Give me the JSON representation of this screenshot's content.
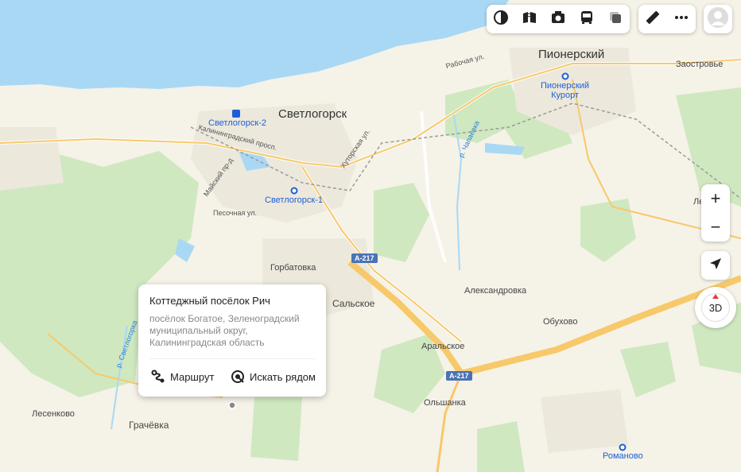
{
  "map_labels": {
    "pionersky": "Пионерский",
    "zaostrovye": "Заостровье",
    "pionersky_kurort": "Пионерский\nКурорт",
    "svetlogorsk": "Светлогорск",
    "svetlogorsk2": "Светлогорск-2",
    "svetlogorsk1": "Светлогорск-1",
    "kaliningradsky": "Калининградский просп.",
    "maysky": "Майский пр-д",
    "pesochnaya": "Песочная ул.",
    "khutorskaya": "Хуторская ул.",
    "rabochaya": "Рабочая ул.",
    "chapayevka": "р. Чапаевка",
    "svetlogorka": "р. Светлогорка",
    "gorbatovka": "Горбатовка",
    "salskoe": "Сальское",
    "aleksandrovka": "Александровка",
    "obukhovo": "Обухово",
    "aralskoe": "Аральское",
    "olshanka": "Ольшанка",
    "lesenkovo": "Лесенково",
    "grachevka": "Грачёвка",
    "romanovo": "Романово",
    "le": "Ле",
    "road_a217_1": "A-217",
    "road_a217_2": "A-217"
  },
  "popup": {
    "title": "Коттеджный посёлок Рич",
    "address": "посёлок Богатое, Зеленоградский муниципальный округ, Калининградская область",
    "route_label": "Маршрут",
    "nearby_label": "Искать рядом"
  },
  "controls": {
    "zoom_in": "+",
    "zoom_out": "−",
    "mode_3d": "3D"
  },
  "colors": {
    "sea": "#a9d8f5",
    "land": "#f5f2e8",
    "forest": "#cfe8c0",
    "road_major": "#f7c96a",
    "station": "#1d5fd6",
    "shield": "#4a73b6"
  }
}
